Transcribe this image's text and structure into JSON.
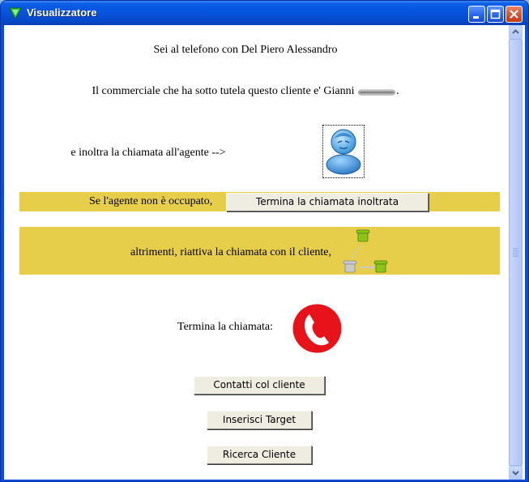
{
  "window": {
    "title": "Visualizzatore"
  },
  "content": {
    "line1": "Sei al telefono con Del Piero Alessandro",
    "line2_prefix": "Il commerciale che ha sotto tutela questo cliente e' Gianni",
    "line2_suffix": ".",
    "line3": "e inoltra la chiamata all'agente -->",
    "band1_text": "Se l'agente non è occupato,",
    "band1_button": "Termina la chiamata inoltrata",
    "band2_text": "altrimenti, riattiva la chiamata con il cliente,",
    "hangup_label": "Termina la chiamata:",
    "buttons": {
      "contacts": "Contatti col cliente",
      "target": "Inserisci Target",
      "search": "Ricerca Cliente"
    }
  },
  "colors": {
    "band": "#e6cd4a",
    "hangup": "#e8131a",
    "phone_green": "#8cc41a",
    "titlebar": "#0752dc"
  },
  "icons": {
    "title": "green-triangle-icon",
    "agent": "user-avatar-icon",
    "redacted_name": "redacted-name-icon",
    "transfer": "phone-transfer-icon",
    "hangup": "hangup-phone-icon"
  }
}
